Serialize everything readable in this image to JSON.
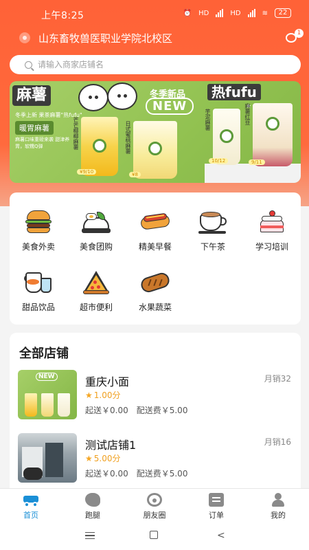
{
  "status_bar": {
    "time": "上午8:25",
    "network_1": "HD",
    "network_2": "HD",
    "battery": "22"
  },
  "header": {
    "location": "山东畜牧兽医职业学院北校区",
    "location_icon": "location-icon",
    "message_icon": "message-icon",
    "message_badge": "1"
  },
  "search": {
    "placeholder": "请输入商家店铺名"
  },
  "banner": {
    "title_left": "麻薯",
    "subtitle": "冬季上新 果茶麻薯\"热fufu\"",
    "tag": "暖胃麻薯",
    "desc": "麻薯口味重磅来袭 甜津养胃，软糯Q弹",
    "new_top": "冬季新品",
    "new": "NEW",
    "hot": "热fufu",
    "hot_sub": "麻薯",
    "stars": "★★★★★",
    "cups": [
      {
        "label": "芒芒椰椰麻薯",
        "price": "¥9/10"
      },
      {
        "label": "日式蜜桃麻薯",
        "price": "¥8"
      },
      {
        "label": "芋泥麻薯",
        "price": "10/12"
      },
      {
        "label": "麻薯红豆",
        "price": "9/11"
      }
    ]
  },
  "categories": [
    {
      "label": "美食外卖",
      "icon": "burger-icon"
    },
    {
      "label": "美食团购",
      "icon": "bento-icon"
    },
    {
      "label": "精美早餐",
      "icon": "hotdog-icon"
    },
    {
      "label": "下午茶",
      "icon": "coffee-icon"
    },
    {
      "label": "学习培训",
      "icon": "cake-icon"
    },
    {
      "label": "甜品饮品",
      "icon": "drink-icon"
    },
    {
      "label": "超市便利",
      "icon": "pizza-icon"
    },
    {
      "label": "水果蔬菜",
      "icon": "bread-icon"
    }
  ],
  "stores_section": {
    "title": "全部店铺",
    "stores": [
      {
        "name": "重庆小面",
        "rating": "1.00分",
        "min_order": "起送￥0.00",
        "delivery_fee": "配送费￥5.00",
        "monthly_sales": "月销32"
      },
      {
        "name": "测试店铺1",
        "rating": "5.00分",
        "min_order": "起送￥0.00",
        "delivery_fee": "配送费￥5.00",
        "monthly_sales": "月销16"
      }
    ]
  },
  "tabbar": {
    "items": [
      {
        "label": "首页",
        "icon": "home-icon",
        "active": true
      },
      {
        "label": "跑腿",
        "icon": "errand-icon",
        "active": false
      },
      {
        "label": "朋友圈",
        "icon": "moments-icon",
        "active": false
      },
      {
        "label": "订单",
        "icon": "order-icon",
        "active": false
      },
      {
        "label": "我的",
        "icon": "profile-icon",
        "active": false
      }
    ]
  },
  "colors": {
    "brand": "#ff6237",
    "tab_active": "#1a8fd6",
    "rating_star": "#f5a623"
  }
}
